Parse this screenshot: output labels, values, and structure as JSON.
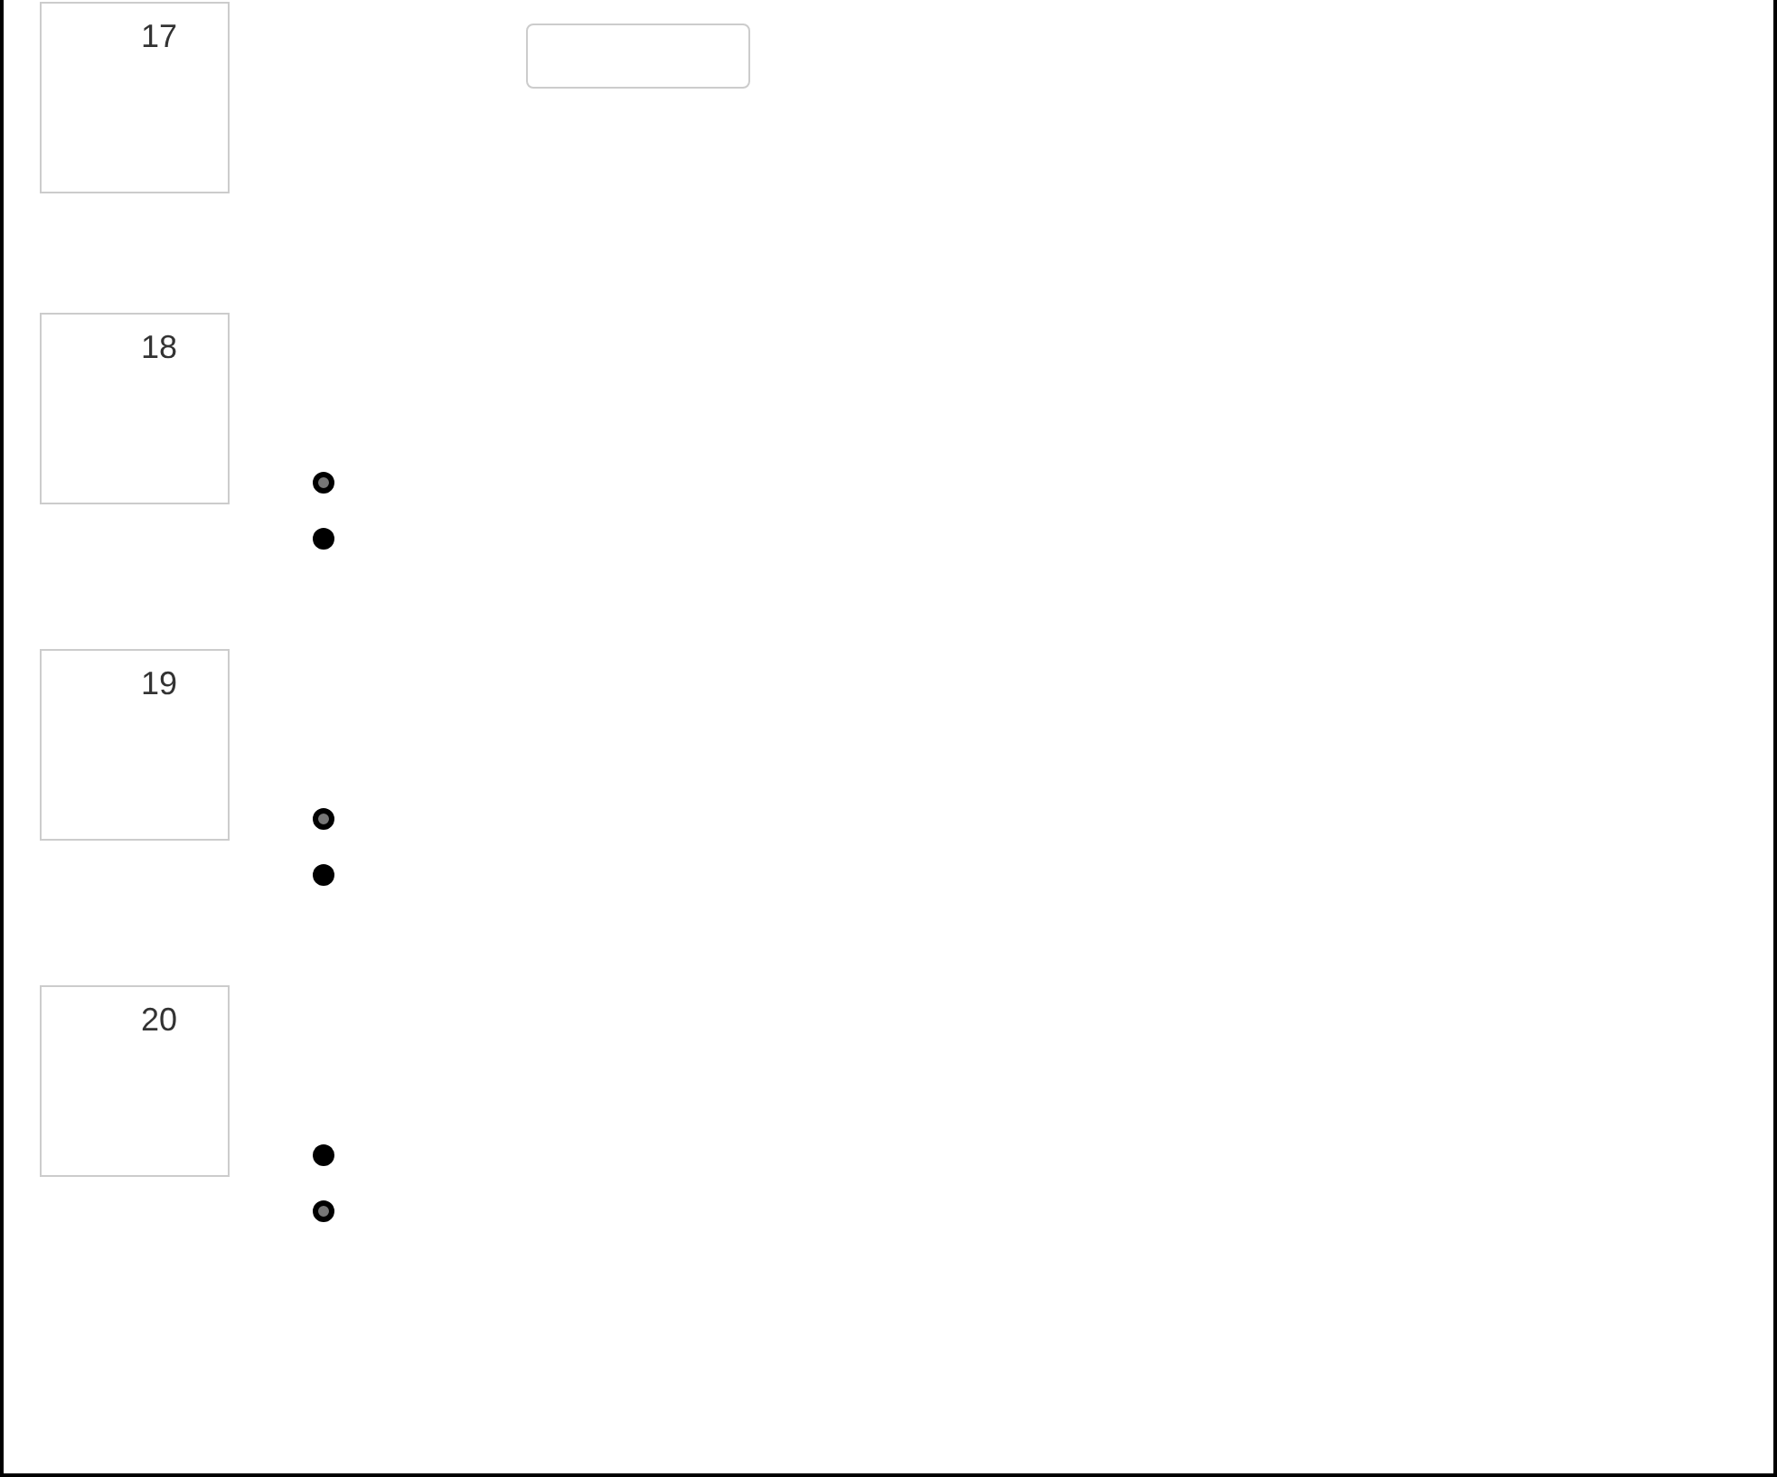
{
  "questions": [
    {
      "number": "17",
      "kind": "text_input"
    },
    {
      "number": "18",
      "kind": "radio",
      "options": [
        {
          "selected": true
        },
        {
          "selected": false
        }
      ]
    },
    {
      "number": "19",
      "kind": "radio",
      "options": [
        {
          "selected": true
        },
        {
          "selected": false
        }
      ]
    },
    {
      "number": "20",
      "kind": "radio",
      "options": [
        {
          "selected": false
        },
        {
          "selected": true
        }
      ]
    }
  ]
}
